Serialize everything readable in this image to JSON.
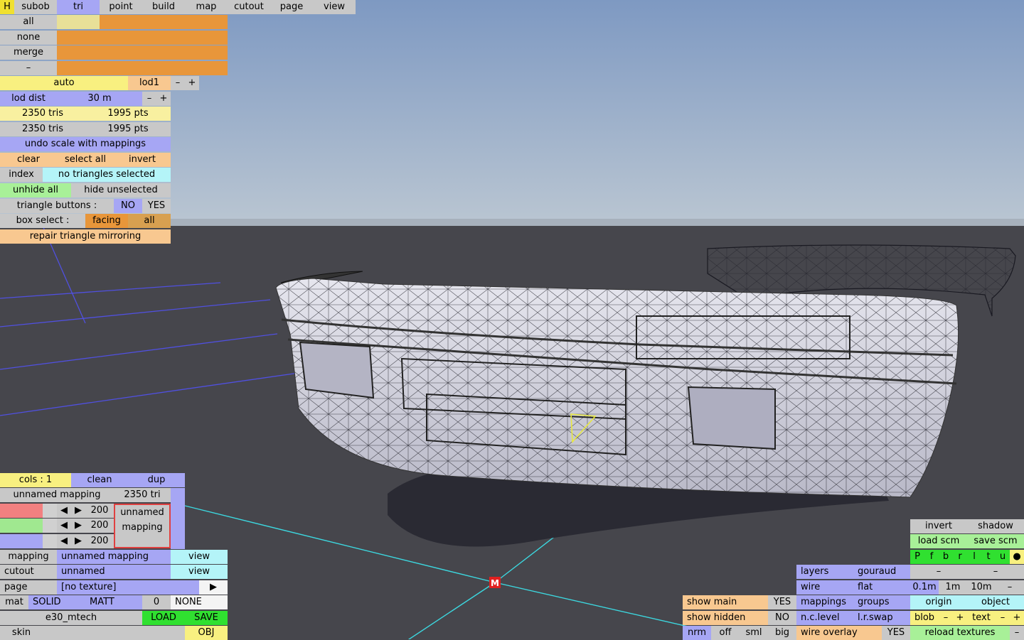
{
  "colors": {
    "sky_top": "#7f9bc3",
    "sky_bottom": "#b9c6d3",
    "ground": "#46464c",
    "grid": "#5a5ae8",
    "axis": "#3cd8e0",
    "mesh": "#e4e4ec",
    "marker": "#e02020"
  },
  "menu": {
    "h": "H",
    "items": [
      "subob",
      "tri",
      "point",
      "build",
      "map",
      "cutout",
      "page",
      "view"
    ]
  },
  "select": {
    "all": "all",
    "none": "none",
    "merge": "merge",
    "minus": "–"
  },
  "lod": {
    "auto": "auto",
    "level": "lod1",
    "minus": "–",
    "plus": "+"
  },
  "lod_dist": {
    "label": "lod dist",
    "value": "30 m",
    "minus": "–",
    "plus": "+"
  },
  "stats": {
    "row1_tris": "2350 tris",
    "row1_pts": "1995 pts",
    "row2_tris": "2350 tris",
    "row2_pts": "1995 pts"
  },
  "undo": "undo scale with mappings",
  "sel": {
    "clear": "clear",
    "select_all": "select all",
    "invert": "invert"
  },
  "index": {
    "label": "index",
    "status": "no triangles selected"
  },
  "hide": {
    "unhide_all": "unhide all",
    "hide_unselected": "hide unselected"
  },
  "tri_buttons": {
    "label": "triangle buttons :",
    "no": "NO",
    "yes": "YES"
  },
  "box_select": {
    "label": "box select :",
    "facing": "facing",
    "all": "all"
  },
  "repair": "repair triangle mirroring",
  "cols_row": {
    "cols": "cols : 1",
    "clean": "clean",
    "dup": "dup"
  },
  "mapping_panel": {
    "name": "unnamed mapping",
    "tris": "2350 tri",
    "v1": "200",
    "v2": "200",
    "v3": "200",
    "preview_line1": "unnamed",
    "preview_line2": "mapping"
  },
  "rows": {
    "mapping": {
      "label": "mapping",
      "value": "unnamed mapping",
      "view": "view"
    },
    "cutout": {
      "label": "cutout",
      "value": "unnamed",
      "view": "view"
    },
    "page": {
      "label": "page",
      "value": "[no texture]",
      "arrow": "▶"
    },
    "mat": {
      "label": "mat",
      "solid": "SOLID",
      "matt": "MATT",
      "num": "0",
      "none": "NONE"
    },
    "file": {
      "name": "e30_mtech",
      "load": "LOAD",
      "save": "SAVE"
    },
    "skin": {
      "label": "skin",
      "obj": "OBJ"
    }
  },
  "right_panel": {
    "invert": "invert",
    "shadow": "shadow",
    "load_scm": "load scm",
    "save_scm": "save scm",
    "letters": [
      "P",
      "f",
      "b",
      "r",
      "l",
      "t",
      "u",
      "●"
    ],
    "layers": "layers",
    "gouraud": "gouraud",
    "dash1": "–",
    "dash2": "–",
    "wire": "wire",
    "flat": "flat",
    "m01": "0.1m",
    "m1": "1m",
    "m10": "10m",
    "mminus": "–",
    "mappings": "mappings",
    "groups": "groups",
    "origin": "origin",
    "object": "object",
    "nclevel": "n.c.level",
    "lrswap": "l.r.swap",
    "blob": "blob",
    "blob_minus": "–",
    "blob_plus": "+",
    "text": "text",
    "text_minus": "–",
    "text_plus": "+",
    "wire_overlay": "wire overlay",
    "wire_overlay_value": "YES",
    "reload": "reload textures",
    "last_minus": "–"
  },
  "show": {
    "main": "show main",
    "main_value": "YES",
    "hidden": "show hidden",
    "hidden_value": "NO"
  },
  "norm": {
    "nrm": "nrm",
    "off": "off",
    "sml": "sml",
    "big": "big"
  },
  "marker": "M"
}
